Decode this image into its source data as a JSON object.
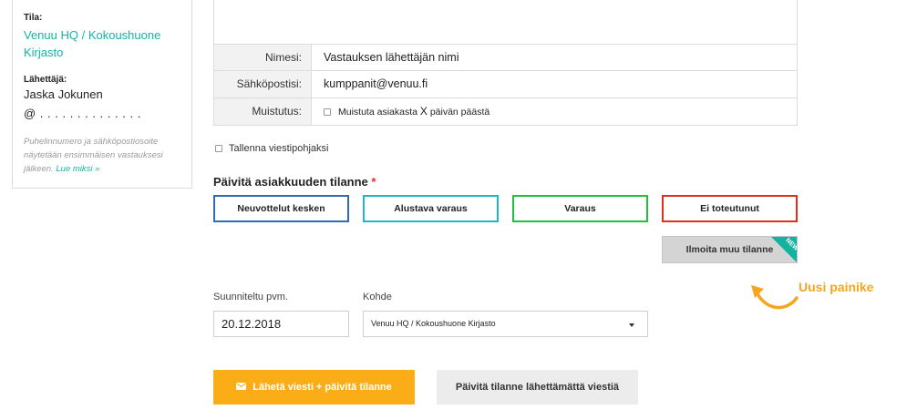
{
  "sidebar": {
    "space_label": "Tila:",
    "space_value": "Venuu HQ / Kokoushuone Kirjasto",
    "sender_label": "Lähettäjä:",
    "sender_name": "Jaska Jokunen",
    "sender_email": "@ . . . . . . . . . . . . . .",
    "note": "Puhelinnumero ja sähköpostiosoite näytetään ensimmäisen vastauksesi jälkeen.",
    "note_link": "Lue miksi »"
  },
  "form": {
    "name_label": "Nimesi:",
    "name_placeholder": "Vastauksen lähettäjän nimi",
    "email_label": "Sähköpostisi:",
    "email_value": "kumppanit@venuu.fi",
    "reminder_label": "Muistutus:",
    "reminder_text_before": "Muistuta asiakasta",
    "reminder_x": "X",
    "reminder_text_after": "päivän päästä",
    "save_template": "Tallenna viestipohjaksi"
  },
  "status": {
    "title": "Päivitä asiakkuuden tilanne",
    "required_mark": "*",
    "buttons": [
      "Neuvottelut kesken",
      "Alustava varaus",
      "Varaus",
      "Ei toteutunut"
    ],
    "colors": [
      "#2c6db3",
      "#1fb7cc",
      "#1ec13a",
      "#e0311f"
    ],
    "other_button": "Ilmoita muu tilanne",
    "new_badge": "NEW"
  },
  "annotation": {
    "label": "Uusi painike",
    "color": "#f7a51c"
  },
  "planning": {
    "date_label": "Suunniteltu pvm.",
    "date_value": "20.12.2018",
    "target_label": "Kohde",
    "target_value": "Venuu HQ / Kokoushuone Kirjasto"
  },
  "actions": {
    "send_icon": "envelope-icon",
    "send_label": "Lähetä viesti + päivitä tilanne",
    "send_color": "#fbad18",
    "update_only_label": "Päivitä tilanne lähettämättä viestiä"
  }
}
